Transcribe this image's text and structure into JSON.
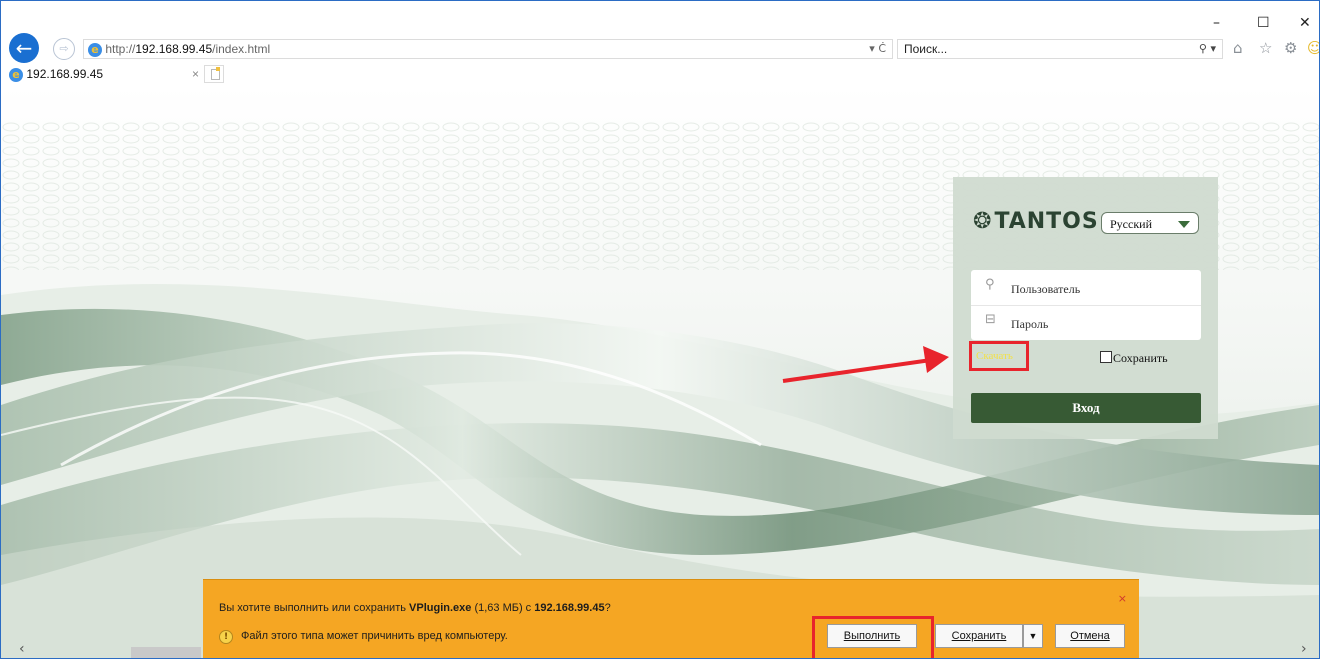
{
  "browser": {
    "url_prefix": "http://",
    "url_host": "192.168.99.45",
    "url_path": "/index.html",
    "address_controls": "▾ Ċ",
    "search_placeholder": "Поиск...",
    "search_controls": "⚲ ▾",
    "window_controls": {
      "minimize": "–",
      "maximize": "☐",
      "close": "✕"
    },
    "tab": {
      "title": "192.168.99.45",
      "close": "×"
    },
    "toolbar_icons": [
      "home-icon",
      "star-icon",
      "gear-icon",
      "smiley-icon"
    ]
  },
  "login": {
    "brand": "TANTOS",
    "language": "Русский",
    "username_placeholder": "Пользователь",
    "password_placeholder": "Пароль",
    "download_link": "Скачать",
    "remember_label": "Сохранить",
    "submit_label": "Вход"
  },
  "download_bar": {
    "question_prefix": "Вы хотите выполнить или сохранить ",
    "file_name": "VPlugin.exe",
    "file_size": " (1,63 МБ) с ",
    "source": "192.168.99.45",
    "question_suffix": "?",
    "warning": "Файл этого типа может причинить вред компьютеру.",
    "run_label": "Выполнить",
    "save_label": "Сохранить",
    "cancel_label": "Отмена",
    "close": "×"
  },
  "nav": {
    "left": "‹",
    "right": "›"
  },
  "colors": {
    "highlight_red": "#e8242c",
    "login_button": "#375a34",
    "download_bar": "#f5a623",
    "ie_blue": "#1a6fd1"
  }
}
